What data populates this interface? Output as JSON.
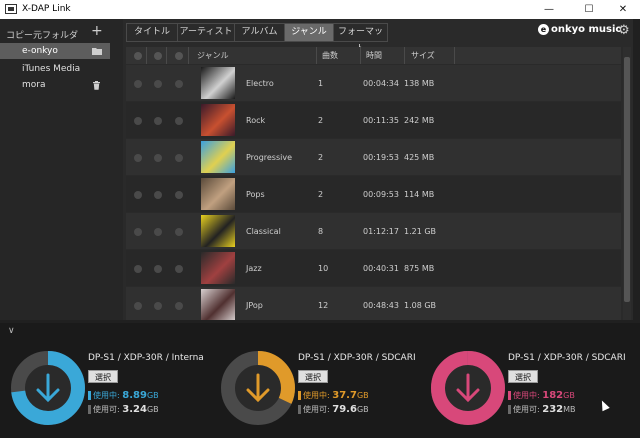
{
  "window": {
    "title": "X-DAP Link",
    "min": "—",
    "max": "☐",
    "close": "✕"
  },
  "sidebar": {
    "header": "コピー元フォルダ",
    "add": "+",
    "items": [
      {
        "label": "e-onkyo",
        "active": true,
        "icon": "folder-icon"
      },
      {
        "label": "iTunes Media",
        "active": false
      },
      {
        "label": "mora",
        "active": false,
        "icon": "trash-icon"
      }
    ]
  },
  "tabs": [
    {
      "label": "タイトル",
      "active": false
    },
    {
      "label": "アーティスト",
      "active": false
    },
    {
      "label": "アルバム",
      "active": false
    },
    {
      "label": "ジャンル",
      "active": true
    },
    {
      "label": "フォーマット",
      "active": false
    }
  ],
  "brand": {
    "logo": "e",
    "name": "onkyo music"
  },
  "table": {
    "headers": {
      "genre": "ジャンル",
      "count": "曲数",
      "time": "時間",
      "size": "サイズ"
    },
    "rows": [
      {
        "genre": "Electro",
        "count": "1",
        "time": "00:04:34",
        "size": "138 MB",
        "colors": [
          "#1a1a1a",
          "#d0d0d0"
        ]
      },
      {
        "genre": "Rock",
        "count": "2",
        "time": "00:11:35",
        "size": "242 MB",
        "colors": [
          "#3a1a2a",
          "#c85030"
        ]
      },
      {
        "genre": "Progressive",
        "count": "2",
        "time": "00:19:53",
        "size": "425 MB",
        "colors": [
          "#3aa0e0",
          "#e0d050"
        ]
      },
      {
        "genre": "Pops",
        "count": "2",
        "time": "00:09:53",
        "size": "114 MB",
        "colors": [
          "#5a4a3a",
          "#c0a080"
        ]
      },
      {
        "genre": "Classical",
        "count": "8",
        "time": "01:12:17",
        "size": "1.21 GB",
        "colors": [
          "#e8d020",
          "#222222"
        ]
      },
      {
        "genre": "Jazz",
        "count": "10",
        "time": "00:40:31",
        "size": "875 MB",
        "colors": [
          "#2a2a2a",
          "#a04040"
        ]
      },
      {
        "genre": "JPop",
        "count": "12",
        "time": "00:48:43",
        "size": "1.08 GB",
        "colors": [
          "#d8d0d0",
          "#503030"
        ]
      }
    ]
  },
  "devices": [
    {
      "name": "DP-S1 / XDP-30R / Interna",
      "select": "選択",
      "used_label": "使用中:",
      "used_value": "8.89",
      "used_unit": "GB",
      "free_label": "使用可:",
      "free_value": "3.24",
      "free_unit": "GB",
      "color": "#3aa8d8",
      "used_fraction": 0.73
    },
    {
      "name": "DP-S1 / XDP-30R / SDCARI",
      "select": "選択",
      "used_label": "使用中:",
      "used_value": "37.7",
      "used_unit": "GB",
      "free_label": "使用可:",
      "free_value": "79.6",
      "free_unit": "GB",
      "color": "#e09a2a",
      "used_fraction": 0.32
    },
    {
      "name": "DP-S1 / XDP-30R / SDCARI",
      "select": "選択",
      "used_label": "使用中:",
      "used_value": "182",
      "used_unit": "GB",
      "free_label": "使用可:",
      "free_value": "232",
      "free_unit": "MB",
      "color": "#d8487a",
      "used_fraction": 0.998
    }
  ]
}
